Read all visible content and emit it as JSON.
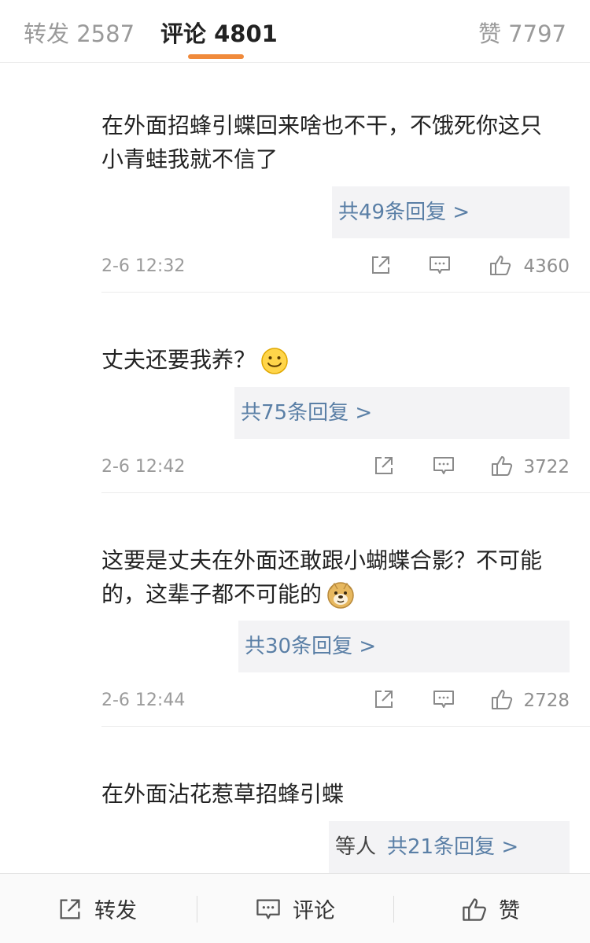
{
  "tabs": {
    "repost": "转发 2587",
    "comments": "评论 4801",
    "likes": "赞 7797"
  },
  "comments": [
    {
      "text": "在外面招蜂引蝶回来啥也不干，不饿死你这只小青蛙我就不信了",
      "replies": "共49条回复 >",
      "time": "2-6 12:32",
      "likes": "4360"
    },
    {
      "text": "丈夫还要我养？",
      "emoji": "smile-emoji",
      "replies": "共75条回复 >",
      "time": "2-6 12:42",
      "likes": "3722"
    },
    {
      "text": "这要是丈夫在外面还敢跟小蝴蝶合影？不可能的，这辈子都不可能的",
      "emoji": "doge-emoji",
      "replies": "共30条回复 >",
      "time": "2-6 12:44",
      "likes": "2728"
    },
    {
      "text": "在外面沾花惹草招蜂引蝶",
      "reply_prefix": "等人",
      "replies": "共21条回复 >"
    }
  ],
  "bottom_bar": {
    "repost": "转发",
    "comment": "评论",
    "like": "赞"
  },
  "colors": {
    "accent": "#f08a3b",
    "link": "#5a7fa6"
  }
}
